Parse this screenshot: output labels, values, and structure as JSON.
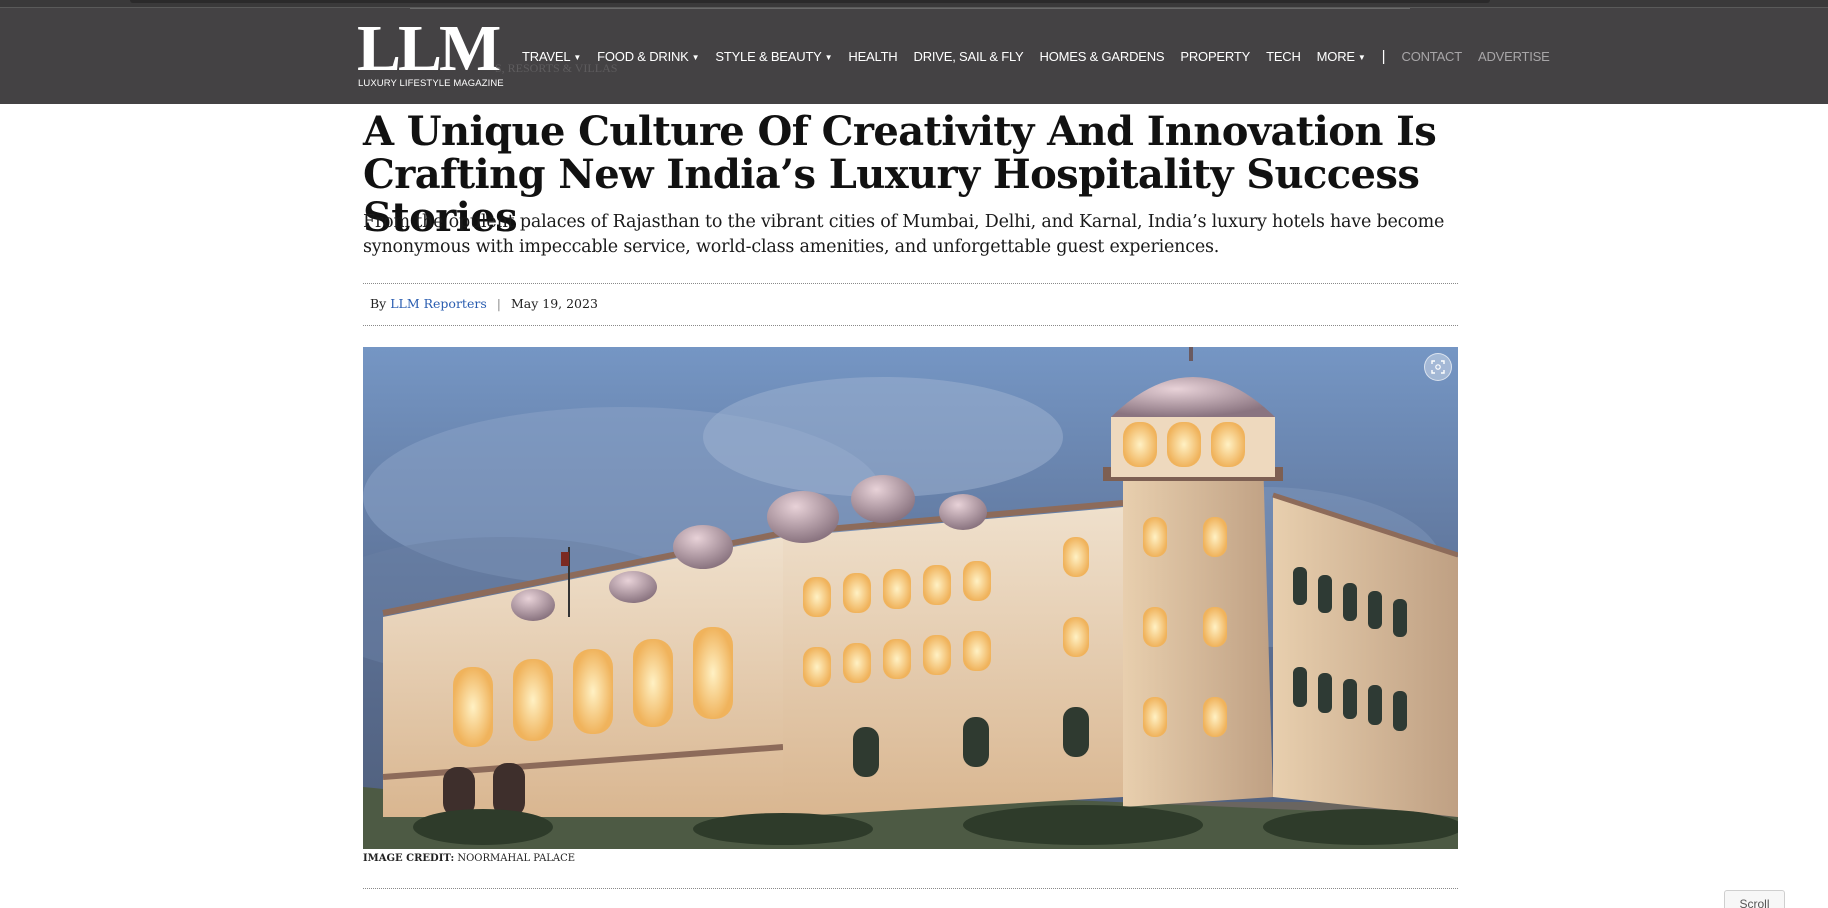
{
  "header": {
    "logo_mark": "LLM",
    "logo_sub": "LUXURY LIFESTYLE MAGAZINE",
    "ghost_breadcrumb": "S, RESORTS & VILLAS",
    "nav": [
      {
        "label": "TRAVEL",
        "has_caret": true
      },
      {
        "label": "FOOD & DRINK",
        "has_caret": true
      },
      {
        "label": "STYLE & BEAUTY",
        "has_caret": true
      },
      {
        "label": "HEALTH",
        "has_caret": false
      },
      {
        "label": "DRIVE, SAIL & FLY",
        "has_caret": false
      },
      {
        "label": "HOMES & GARDENS",
        "has_caret": false
      },
      {
        "label": "PROPERTY",
        "has_caret": false
      },
      {
        "label": "TECH",
        "has_caret": false
      },
      {
        "label": "MORE",
        "has_caret": true
      }
    ],
    "separator": "|",
    "secondary_nav": [
      {
        "label": "CONTACT"
      },
      {
        "label": "ADVERTISE"
      }
    ]
  },
  "article": {
    "headline": "A Unique Culture Of Creativity And Innovation Is Crafting New India’s Luxury Hospitality Success Stories",
    "dek": "From the opulent palaces of Rajasthan to the vibrant cities of Mumbai, Delhi, and Karnal, India’s luxury hotels have become synonymous with impeccable service, world-class amenities, and unforgettable guest experiences.",
    "byline_prefix": "By",
    "author": "LLM Reporters",
    "byline_sep": "|",
    "date": "May 19, 2023",
    "image_credit_label": "IMAGE CREDIT:",
    "image_credit_value": "NOORMAHAL PALACE"
  },
  "scroll_label": "Scroll",
  "colors": {
    "header_bg": "#444244",
    "link": "#2a5db0",
    "muted_nav": "#a8a6a8"
  },
  "icons": {
    "nav_caret": "chevron-down-icon",
    "hero_zoom": "expand-icon"
  }
}
